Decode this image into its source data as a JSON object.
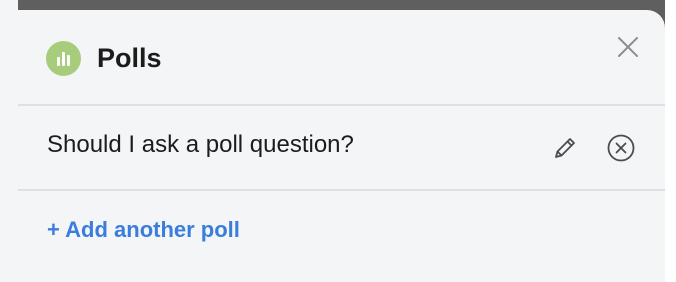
{
  "panel": {
    "title": "Polls",
    "icon": "poll-bar-chart-icon",
    "close_icon": "close-icon"
  },
  "poll": {
    "question": "Should I ask a poll question?",
    "edit_icon": "pencil-icon",
    "remove_icon": "circle-x-icon"
  },
  "actions": {
    "add_poll_label": "+ Add another poll"
  },
  "colors": {
    "accent": "#3b7ddd",
    "poll_icon_bg": "#a7cd7c",
    "panel_bg": "#f4f5f7"
  }
}
